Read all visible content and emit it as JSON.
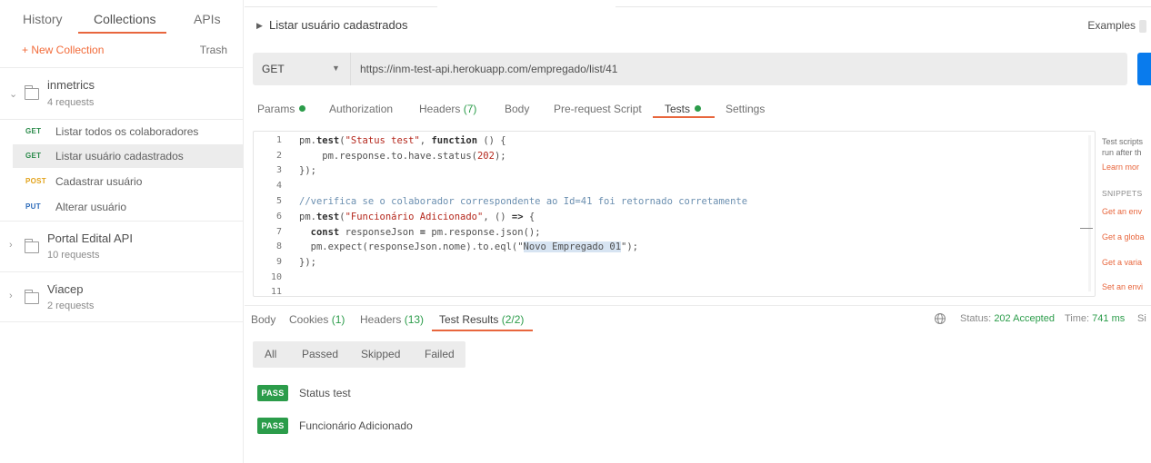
{
  "sidebar": {
    "tabs": [
      "History",
      "Collections",
      "APIs"
    ],
    "new_collection": "+ New Collection",
    "trash": "Trash",
    "collections": [
      {
        "name": "inmetrics",
        "count": "4 requests",
        "requests": [
          {
            "method": "GET",
            "name": "Listar todos os colaboradores"
          },
          {
            "method": "GET",
            "name": "Listar usuário cadastrados"
          },
          {
            "method": "POST",
            "name": "Cadastrar usuário"
          },
          {
            "method": "PUT",
            "name": "Alterar usuário"
          }
        ]
      },
      {
        "name": "Portal Edital API",
        "count": "10 requests"
      },
      {
        "name": "Viacep",
        "count": "2 requests"
      }
    ]
  },
  "request": {
    "title": "Listar usuário cadastrados",
    "examples_label": "Examples",
    "method": "GET",
    "url": "https://inm-test-api.herokuapp.com/empregado/list/41",
    "tabs": [
      "Params",
      "Authorization",
      "Headers",
      "Body",
      "Pre-request Script",
      "Tests",
      "Settings"
    ],
    "headers_count": "(7)"
  },
  "editor": {
    "line_numbers": [
      "1",
      "2",
      "3",
      "4",
      "5",
      "6",
      "7",
      "8",
      "9",
      "10",
      "11"
    ],
    "lines": {
      "l1_a": "pm.",
      "l1_b": "test",
      "l1_c": "(",
      "l1_d": "\"Status test\"",
      "l1_e": ", ",
      "l1_f": "function",
      "l1_g": " () {",
      "l2_a": "    pm.response.to.have.status(",
      "l2_b": "202",
      "l2_c": ");",
      "l3": "});",
      "l5": "//verifica se o colaborador correspondente ao Id=41 foi retornado corretamente",
      "l6_a": "pm.",
      "l6_b": "test",
      "l6_c": "(",
      "l6_d": "\"Funcionário Adicionado\"",
      "l6_e": ", () ",
      "l6_f": "=>",
      "l6_g": " {",
      "l7_a": "  const",
      "l7_b": " responseJson ",
      "l7_c": "=",
      "l7_d": " pm.response.json();",
      "l8_a": "  pm.expect(responseJson.nome).to.eql(\"",
      "l8_b": "Novo Empregado 01",
      "l8_c": "\");",
      "l9": "});"
    }
  },
  "snippets_panel": {
    "t1": "Test scripts",
    "t2": "run after th",
    "learn": "Learn mor",
    "heading": "SNIPPETS",
    "links": [
      "Get an env",
      "Get a globa",
      "Get a varia",
      "Set an envi"
    ]
  },
  "response": {
    "tabs": {
      "body": "Body",
      "cookies": "Cookies",
      "cookies_count": "(1)",
      "headers": "Headers",
      "headers_count": "(13)",
      "test_results": "Test Results",
      "test_results_count": "(2/2)"
    },
    "status_label": "Status:",
    "status_value": "202 Accepted",
    "time_label": "Time:",
    "time_value": "741 ms",
    "size_label": "Si",
    "filters": [
      "All",
      "Passed",
      "Skipped",
      "Failed"
    ],
    "results": [
      {
        "badge": "PASS",
        "name": "Status test"
      },
      {
        "badge": "PASS",
        "name": "Funcionário Adicionado"
      }
    ]
  },
  "colors": {
    "accent": "#e8663d",
    "pass": "#2b9c4a",
    "send": "#097bed"
  }
}
